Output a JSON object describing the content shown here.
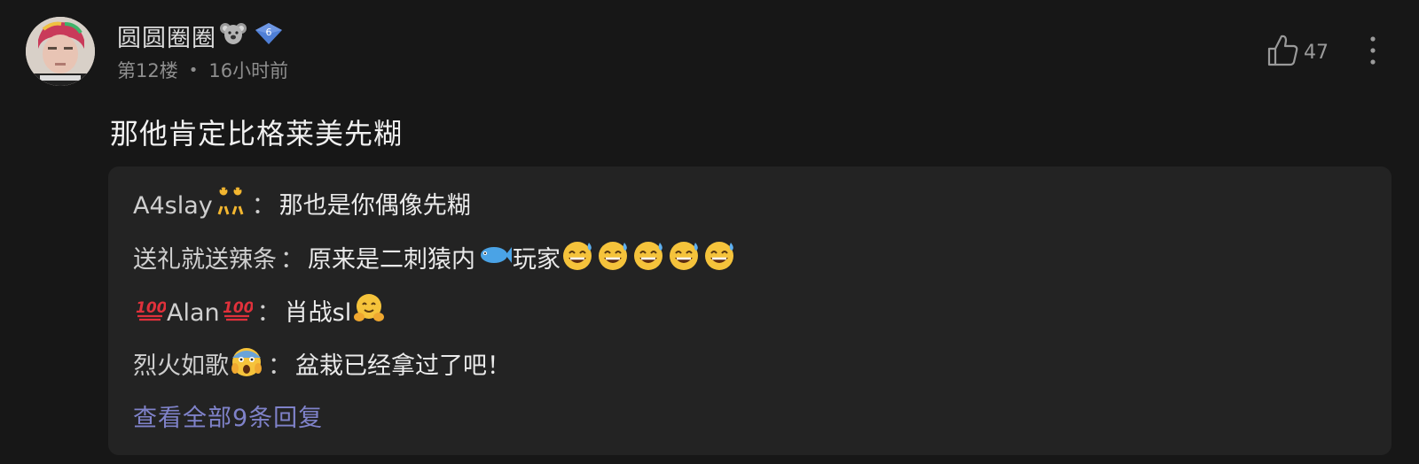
{
  "author": {
    "name": "圆圆圈圈",
    "name_emoji": "koala-emoji",
    "level": "6",
    "floor": "第12楼",
    "meta_separator": "•",
    "time": "16小时前"
  },
  "like": {
    "count": "47",
    "icon": "thumbs-up-icon"
  },
  "more_icon": "more-vertical-icon",
  "comment_text": "那他肯定比格莱美先糊",
  "separator": "：",
  "replies": [
    {
      "user": "A4slay",
      "user_suffix_emoji": "dancers-emoji",
      "text": "那也是你偶像先糊"
    },
    {
      "user": "送礼就送辣条",
      "text_a": "原来是二刺猿内",
      "text_b": "玩家",
      "inline_emoji": "fish-emoji",
      "trailing_emoji": "grinning-sweat-emoji x5"
    },
    {
      "user_prefix_emoji": "hundred-points-emoji",
      "user": "Alan",
      "user_suffix_emoji": "hundred-points-emoji",
      "text": "肖战sl",
      "trailing_emoji": "hugging-face-emoji"
    },
    {
      "user": "烈火如歌",
      "user_suffix_emoji": "screaming-face-emoji",
      "text": "盆栽已经拿过了吧！"
    }
  ],
  "view_all": "查看全部9条回复",
  "colors": {
    "background": "#171717",
    "reply_panel": "#232323",
    "link": "#7f82c9",
    "badge": "#4f7fd6"
  }
}
